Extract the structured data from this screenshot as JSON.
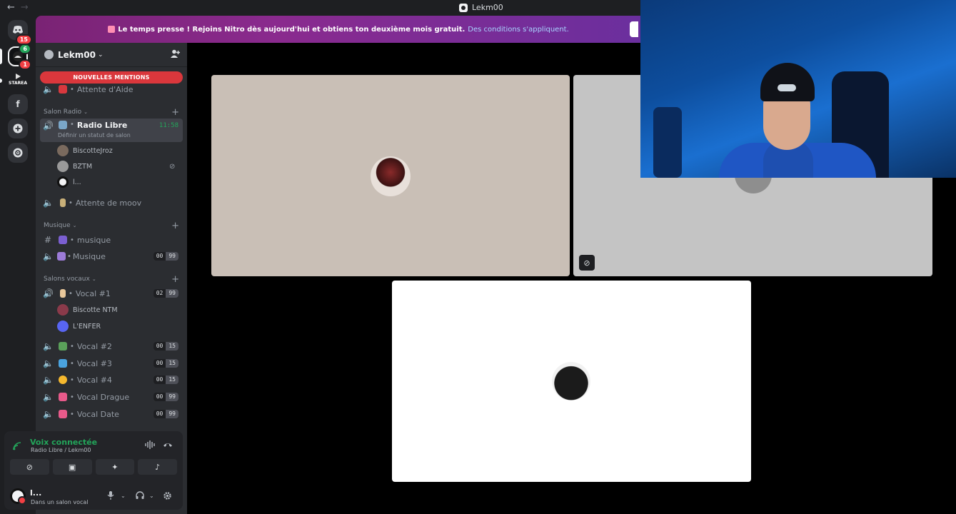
{
  "window": {
    "title": "Lekm00",
    "back": "←",
    "forward": "→"
  },
  "rail": {
    "dm_badge": "15",
    "active_badge": "1",
    "active_green_badge": "6",
    "starea_label": "STAREA",
    "f_label": "f",
    "add_label": "+"
  },
  "banner": {
    "text": "Le temps presse ! Rejoins Nitro dès aujourd'hui et obtiens ton deuxième mois gratuit.",
    "link": "Des conditions s'appliquent."
  },
  "guild": {
    "name": "Lekm00",
    "chevron": "⌄"
  },
  "mentions_label": "NOUVELLES MENTIONS",
  "channels_top": [
    {
      "name": "Attente d'Aide"
    }
  ],
  "categories": [
    {
      "name": "Salon Radio"
    },
    {
      "name": "Musique"
    },
    {
      "name": "Salons vocaux"
    }
  ],
  "radio": {
    "name": "Radio Libre",
    "time": "11:58",
    "status": "Définir un statut de salon",
    "users": [
      "BiscotteJroz",
      "BZTM",
      "l..."
    ],
    "after": "Attente de moov"
  },
  "music": {
    "text_channel": "musique",
    "voice_channel": "Musique",
    "voice_count": [
      "00",
      "99"
    ]
  },
  "vocals": [
    {
      "name": "Vocal #1",
      "count": [
        "02",
        "99"
      ],
      "users": [
        "Biscotte NTM",
        "L'ENFER"
      ]
    },
    {
      "name": "Vocal #2",
      "count": [
        "00",
        "15"
      ]
    },
    {
      "name": "Vocal #3",
      "count": [
        "00",
        "15"
      ]
    },
    {
      "name": "Vocal #4",
      "count": [
        "00",
        "15"
      ]
    },
    {
      "name": "Vocal Drague",
      "count": [
        "00",
        "99"
      ]
    },
    {
      "name": "Vocal Date",
      "count": [
        "00",
        "99"
      ]
    }
  ],
  "voice_panel": {
    "title": "Voix connectée",
    "subtitle": "Radio Libre / Lekm00",
    "user_name": "l...",
    "user_status": "Dans un salon vocal"
  },
  "icons": {
    "speaker": "speaker-icon",
    "hash": "hash-icon",
    "mic": "microphone-icon",
    "headset": "headphones-icon",
    "gear": "gear-icon"
  },
  "colors": {
    "green": "#23a55a",
    "red": "#da373c",
    "banner_start": "#7a2374",
    "banner_end": "#6b2f9e"
  }
}
